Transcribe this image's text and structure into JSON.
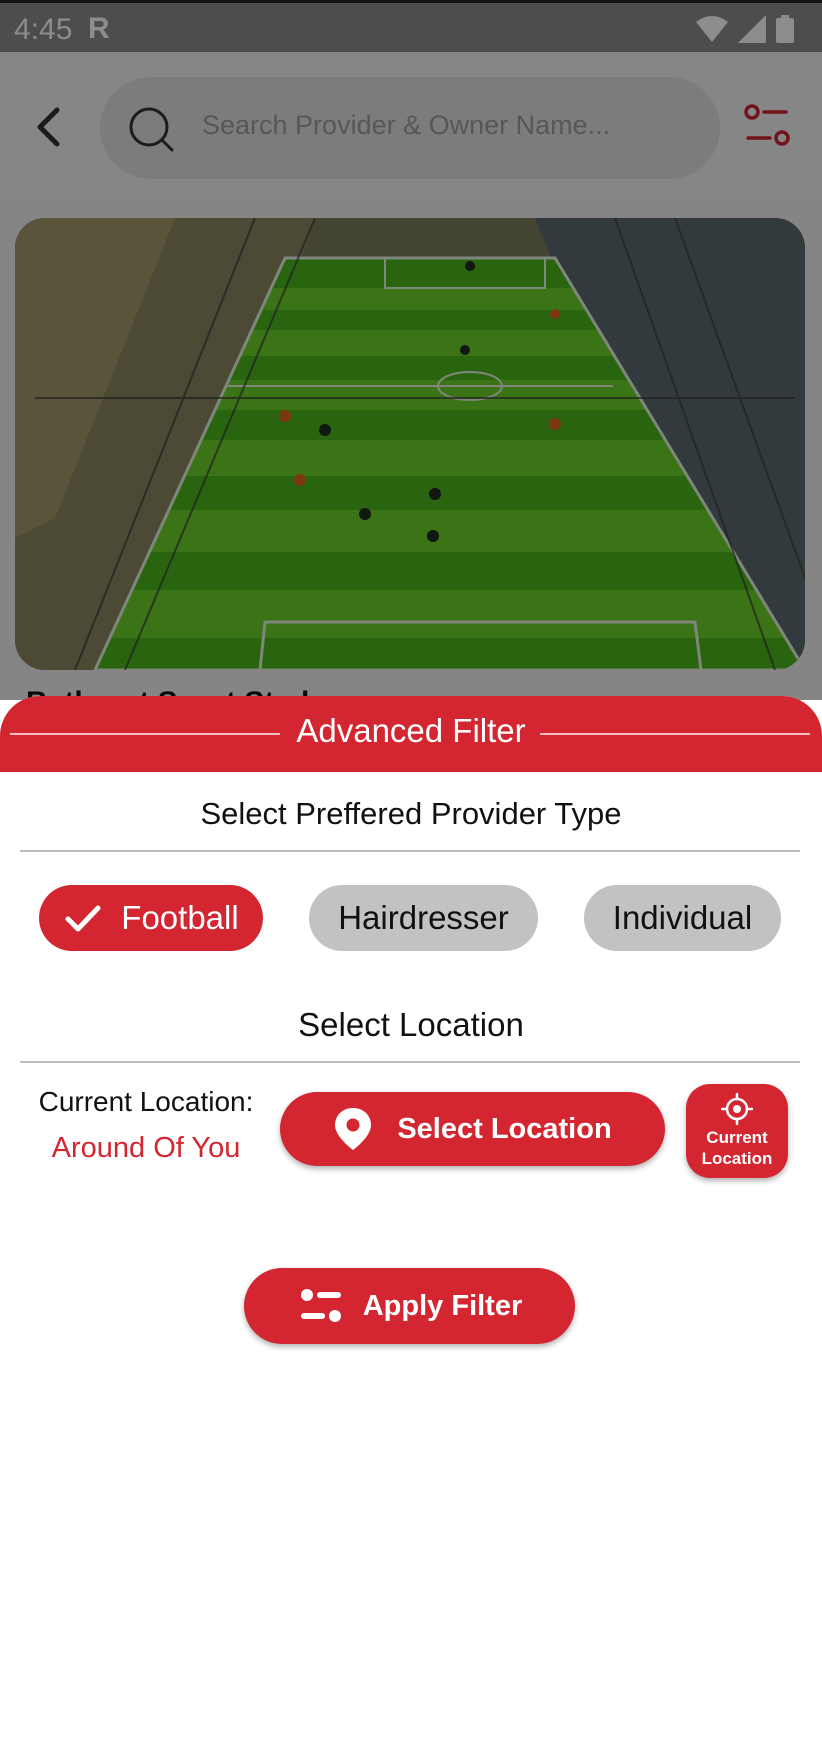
{
  "status_bar": {
    "time": "4:45",
    "carrier_badge": "R",
    "icons": [
      "wifi-icon",
      "signal-icon",
      "battery-icon"
    ]
  },
  "search": {
    "placeholder": "Search Provider & Owner Name..."
  },
  "listing": {
    "title": "Bathurst Sport Stad"
  },
  "filter_sheet": {
    "title": "Advanced Filter",
    "provider_section_title": "Select Preffered Provider Type",
    "provider_types": [
      {
        "label": "Football",
        "selected": true
      },
      {
        "label": "Hairdresser",
        "selected": false
      },
      {
        "label": "Individual",
        "selected": false
      }
    ],
    "location_section_title": "Select Location",
    "current_location_label": "Current Location:",
    "current_location_value": "Around Of You",
    "select_location_button": "Select Location",
    "current_location_button": "Current Location",
    "apply_button": "Apply Filter"
  },
  "colors": {
    "accent": "#d32631",
    "chip_unselected": "#c2c2c2",
    "rule": "#bdbdbd"
  }
}
